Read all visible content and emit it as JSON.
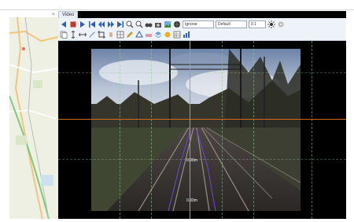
{
  "panel": {
    "tab_label": "Video",
    "close_glyph": "×"
  },
  "toolbar": {
    "row1_icons": [
      "arrow-left-icon",
      "stop-icon",
      "play-icon",
      "skip-start-icon",
      "step-back-icon",
      "step-forward-icon",
      "skip-end-icon",
      "zoom-in-icon",
      "zoom-out-icon",
      "binoculars-icon",
      "camera-icon",
      "image-icon",
      "globe-icon"
    ],
    "dropdown_1": "Ignorar",
    "dropdown_2": "Default",
    "number_value": "0.1",
    "row2_icons": [
      "copy-icon",
      "measure-vertical-icon",
      "measure-horizontal-icon",
      "ruler-icon",
      "crop-icon",
      "hand-icon",
      "grid-icon",
      "pencil-icon",
      "polygon-icon",
      "eraser-icon",
      "layers-icon",
      "sun-icon",
      "table-icon",
      "chart-icon"
    ]
  },
  "viewer": {
    "measure_1": "0.00m",
    "measure_2": "0.00m"
  },
  "colors": {
    "horizon_line": "#d46a1c",
    "center_line": "#4cd35a",
    "toolbar_bg": "#eef3fa",
    "track_marker": "#6a4ad6"
  }
}
